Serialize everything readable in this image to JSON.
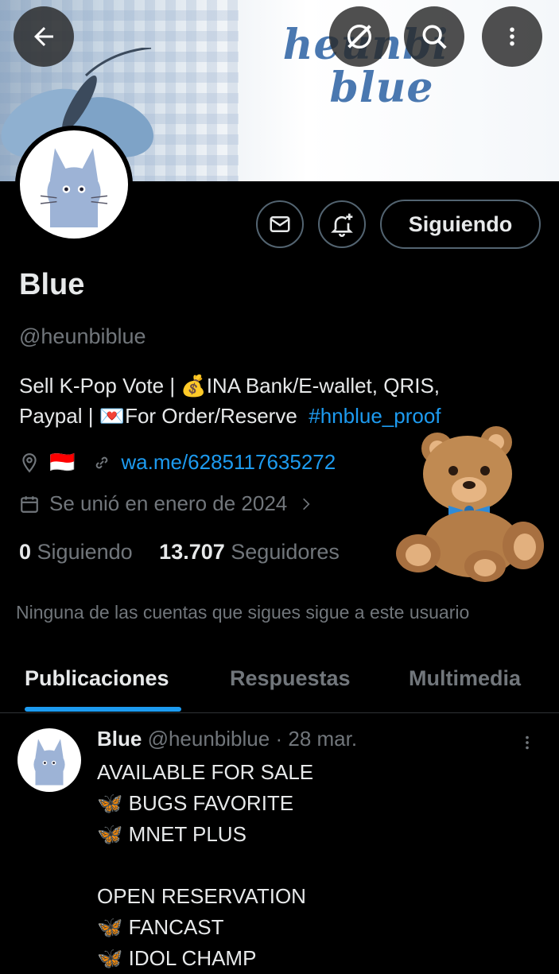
{
  "banner": {
    "title_line1": "heunbi",
    "title_line2": "blue"
  },
  "top_actions": {
    "back": "back-icon",
    "grok": "grok-icon",
    "search": "search-icon",
    "more": "more-icon"
  },
  "profile": {
    "name": "Blue",
    "handle": "@heunbiblue",
    "bio_line1": "Sell K-Pop Vote | 💰INA Bank/E-wallet, QRIS,",
    "bio_line2": "Paypal | 💌For Order/Reserve",
    "bio_hashtag": "#hnblue_proof",
    "location_flag": "🇮🇩",
    "link": "wa.me/6285117635272",
    "joined": "Se unió en enero de 2024",
    "following_count": "0",
    "following_label": "Siguiendo",
    "followers_count": "13.707",
    "followers_label": "Seguidores",
    "no_common": "Ninguna de las cuentas que sigues sigue a este usuario"
  },
  "actions": {
    "follow_label": "Siguiendo"
  },
  "tabs": [
    "Publicaciones",
    "Respuestas",
    "Multimedia"
  ],
  "post": {
    "name": "Blue",
    "handle": "@heunbiblue",
    "sep": "·",
    "date": "28 mar.",
    "lines": [
      "AVAILABLE FOR SALE",
      "🦋 BUGS FAVORITE",
      "🦋 MNET PLUS",
      "",
      "OPEN RESERVATION",
      "🦋 FANCAST",
      "🦋 IDOL CHAMP"
    ]
  },
  "colors": {
    "accent": "#1d9bf0",
    "muted": "#71767b",
    "text": "#e7e9ea",
    "border": "#536471"
  }
}
